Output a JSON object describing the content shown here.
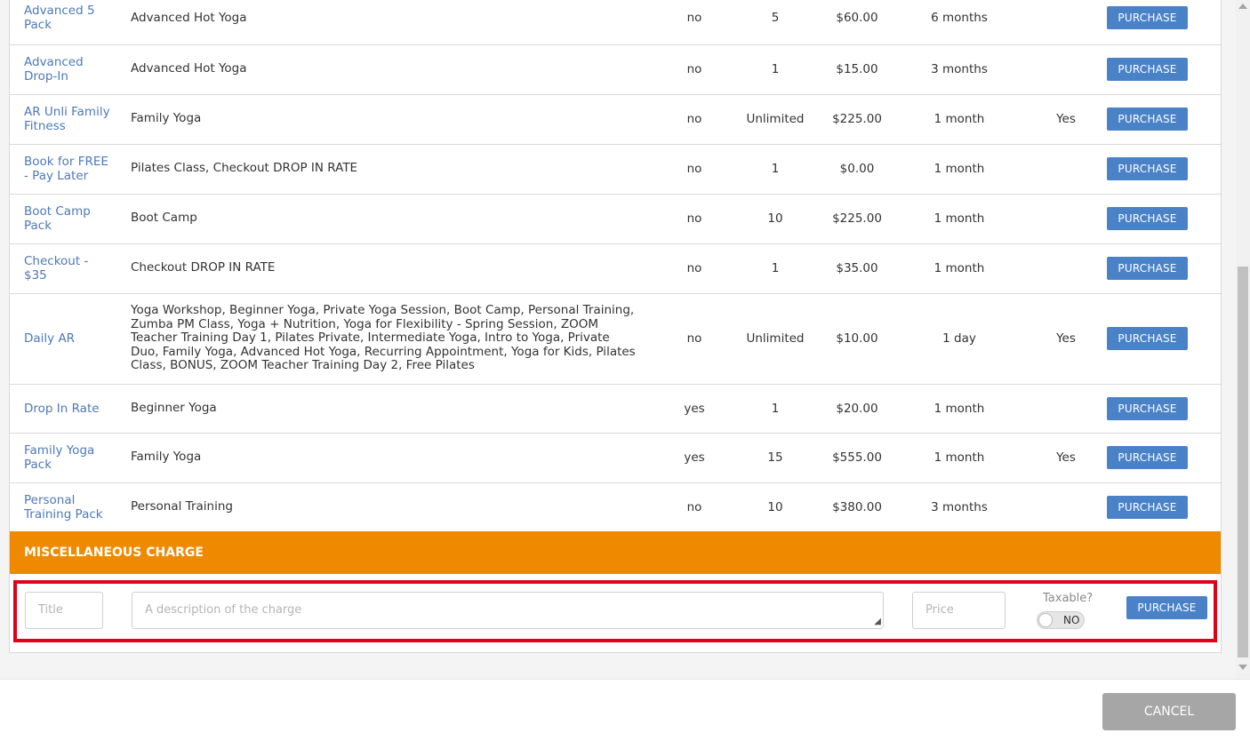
{
  "packages": [
    {
      "name": "Advanced 5 Pack",
      "classes": "Advanced Hot Yoga",
      "col3": "no",
      "sessions": "5",
      "price": "$60.00",
      "expires": "6 months",
      "col7": "",
      "button": "PURCHASE"
    },
    {
      "name": "Advanced Drop-In",
      "classes": "Advanced Hot Yoga",
      "col3": "no",
      "sessions": "1",
      "price": "$15.00",
      "expires": "3 months",
      "col7": "",
      "button": "PURCHASE"
    },
    {
      "name": "AR Unli Family Fitness",
      "classes": "Family Yoga",
      "col3": "no",
      "sessions": "Unlimited",
      "price": "$225.00",
      "expires": "1 month",
      "col7": "Yes",
      "button": "PURCHASE"
    },
    {
      "name": "Book for FREE - Pay Later",
      "classes": "Pilates Class, Checkout DROP IN RATE",
      "col3": "no",
      "sessions": "1",
      "price": "$0.00",
      "expires": "1 month",
      "col7": "",
      "button": "PURCHASE"
    },
    {
      "name": "Boot Camp Pack",
      "classes": "Boot Camp",
      "col3": "no",
      "sessions": "10",
      "price": "$225.00",
      "expires": "1 month",
      "col7": "",
      "button": "PURCHASE"
    },
    {
      "name": "Checkout - $35",
      "classes": "Checkout DROP IN RATE",
      "col3": "no",
      "sessions": "1",
      "price": "$35.00",
      "expires": "1 month",
      "col7": "",
      "button": "PURCHASE"
    },
    {
      "name": "Daily AR",
      "classes": "Yoga Workshop, Beginner Yoga, Private Yoga Session, Boot Camp, Personal Training, Zumba PM Class, Yoga + Nutrition, Yoga for Flexibility - Spring Session, ZOOM Teacher Training Day 1, Pilates Private, Intermediate Yoga, Intro to Yoga, Private Duo, Family Yoga, Advanced Hot Yoga, Recurring Appointment, Yoga for Kids, Pilates Class, BONUS, ZOOM Teacher Training Day 2, Free Pilates",
      "col3": "no",
      "sessions": "Unlimited",
      "price": "$10.00",
      "expires": "1 day",
      "col7": "Yes",
      "button": "PURCHASE"
    },
    {
      "name": "Drop In Rate",
      "classes": "Beginner Yoga",
      "col3": "yes",
      "sessions": "1",
      "price": "$20.00",
      "expires": "1 month",
      "col7": "",
      "button": "PURCHASE"
    },
    {
      "name": "Family Yoga Pack",
      "classes": "Family Yoga",
      "col3": "yes",
      "sessions": "15",
      "price": "$555.00",
      "expires": "1 month",
      "col7": "Yes",
      "button": "PURCHASE"
    },
    {
      "name": "Personal Training Pack",
      "classes": "Personal Training",
      "col3": "no",
      "sessions": "10",
      "price": "$380.00",
      "expires": "3 months",
      "col7": "",
      "button": "PURCHASE"
    }
  ],
  "misc": {
    "header": "MISCELLANEOUS CHARGE",
    "title_placeholder": "Title",
    "description_placeholder": "A description of the charge",
    "price_placeholder": "Price",
    "taxable_label": "Taxable?",
    "taxable_value": "NO",
    "button": "PURCHASE"
  },
  "footer": {
    "cancel": "CANCEL"
  },
  "colors": {
    "link": "#4d79b8",
    "button": "#4a82c8",
    "section_header": "#ef8a00",
    "highlight_border": "#e0001a",
    "cancel_button": "#a6a6a6"
  },
  "icons": {
    "resize": "resize-handle-icon",
    "scroll_up": "scroll-up-arrow-icon",
    "scroll_down": "scroll-down-arrow-icon"
  }
}
